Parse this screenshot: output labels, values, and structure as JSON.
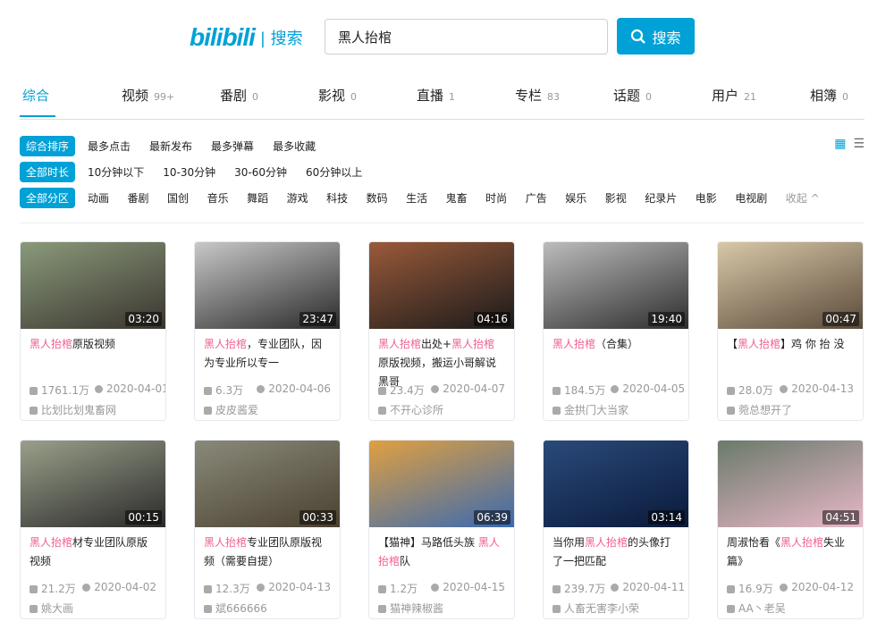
{
  "header": {
    "logo": "bilibili",
    "logo_sub": "| 搜索",
    "query": "黑人抬棺",
    "search_button": "搜索"
  },
  "tabs": [
    {
      "label": "综合",
      "count": ""
    },
    {
      "label": "视频",
      "count": "99+"
    },
    {
      "label": "番剧",
      "count": "0"
    },
    {
      "label": "影视",
      "count": "0"
    },
    {
      "label": "直播",
      "count": "1"
    },
    {
      "label": "专栏",
      "count": "83"
    },
    {
      "label": "话题",
      "count": "0"
    },
    {
      "label": "用户",
      "count": "21"
    },
    {
      "label": "相簿",
      "count": "0"
    }
  ],
  "filters": {
    "order": {
      "label": "综合排序",
      "options": [
        "最多点击",
        "最新发布",
        "最多弹幕",
        "最多收藏"
      ]
    },
    "duration": {
      "label": "全部时长",
      "options": [
        "10分钟以下",
        "10-30分钟",
        "30-60分钟",
        "60分钟以上"
      ]
    },
    "zone": {
      "label": "全部分区",
      "options": [
        "动画",
        "番剧",
        "国创",
        "音乐",
        "舞蹈",
        "游戏",
        "科技",
        "数码",
        "生活",
        "鬼畜",
        "时尚",
        "广告",
        "娱乐",
        "影视",
        "纪录片",
        "电影",
        "电视剧"
      ],
      "fold": "收起 ^"
    }
  },
  "videos": [
    {
      "title": [
        [
          "黑人抬棺",
          1
        ],
        [
          "原版视频",
          0
        ]
      ],
      "duration": "03:20",
      "views": "1761.1万",
      "date": "2020-04-01",
      "uploader": "比划比划鬼畜网",
      "colors": [
        "#8a9a7a",
        "#3a3530"
      ]
    },
    {
      "title": [
        [
          "黑人抬棺",
          1
        ],
        [
          "，专业团队，因为专业所以专一",
          0
        ]
      ],
      "duration": "23:47",
      "views": "6.3万",
      "date": "2020-04-06",
      "uploader": "皮皮酱爱",
      "colors": [
        "#c8c8c8",
        "#2a2a2a"
      ]
    },
    {
      "title": [
        [
          "黑人抬棺",
          1
        ],
        [
          "出处+",
          0
        ],
        [
          "黑人抬棺",
          1
        ],
        [
          "原版视频，搬运小哥解说黑哥",
          0
        ]
      ],
      "duration": "04:16",
      "views": "23.4万",
      "date": "2020-04-07",
      "uploader": "不开心诊所",
      "colors": [
        "#9a5a3a",
        "#1a1a1a"
      ]
    },
    {
      "title": [
        [
          "黑人抬棺",
          1
        ],
        [
          "（合集）",
          0
        ]
      ],
      "duration": "19:40",
      "views": "184.5万",
      "date": "2020-04-05",
      "uploader": "金拱门大当家",
      "colors": [
        "#bcbcbc",
        "#2e2e2e"
      ]
    },
    {
      "title": [
        [
          "【",
          0
        ],
        [
          "黑人抬棺",
          1
        ],
        [
          "】鸡 你 抬 没",
          0
        ]
      ],
      "duration": "00:47",
      "views": "28.0万",
      "date": "2020-04-13",
      "uploader": "菀总想开了",
      "colors": [
        "#d8c8a8",
        "#5a4a3a"
      ]
    },
    {
      "title": [
        [
          "黑人抬棺",
          1
        ],
        [
          "材专业团队原版视频",
          0
        ]
      ],
      "duration": "00:15",
      "views": "21.2万",
      "date": "2020-04-02",
      "uploader": "姚大画",
      "colors": [
        "#9aa08a",
        "#2a2a2a"
      ]
    },
    {
      "title": [
        [
          "黑人抬棺",
          1
        ],
        [
          "专业团队原版视频（需要自提）",
          0
        ]
      ],
      "duration": "00:33",
      "views": "12.3万",
      "date": "2020-04-13",
      "uploader": "斌666666",
      "colors": [
        "#8a8a7a",
        "#4a4030"
      ]
    },
    {
      "title": [
        [
          "【猫神】马路低头族 ",
          0
        ],
        [
          "黑人抬棺",
          1
        ],
        [
          "队",
          0
        ]
      ],
      "duration": "06:39",
      "views": "1.2万",
      "date": "2020-04-15",
      "uploader": "猫神辣椒酱",
      "colors": [
        "#e0a040",
        "#3a6ab0"
      ]
    },
    {
      "title": [
        [
          "当你用",
          0
        ],
        [
          "黑人抬棺",
          1
        ],
        [
          "的头像打了一把匹配",
          0
        ]
      ],
      "duration": "03:14",
      "views": "239.7万",
      "date": "2020-04-11",
      "uploader": "人畜无害李小荣",
      "colors": [
        "#2a4a7a",
        "#0a1a3a"
      ]
    },
    {
      "title": [
        [
          "周淑怡看《",
          0
        ],
        [
          "黑人抬棺",
          1
        ],
        [
          "失业篇》",
          0
        ]
      ],
      "duration": "04:51",
      "views": "16.9万",
      "date": "2020-04-12",
      "uploader": "AA丶老吴",
      "colors": [
        "#6a7a6a",
        "#e8b8c8"
      ]
    }
  ]
}
